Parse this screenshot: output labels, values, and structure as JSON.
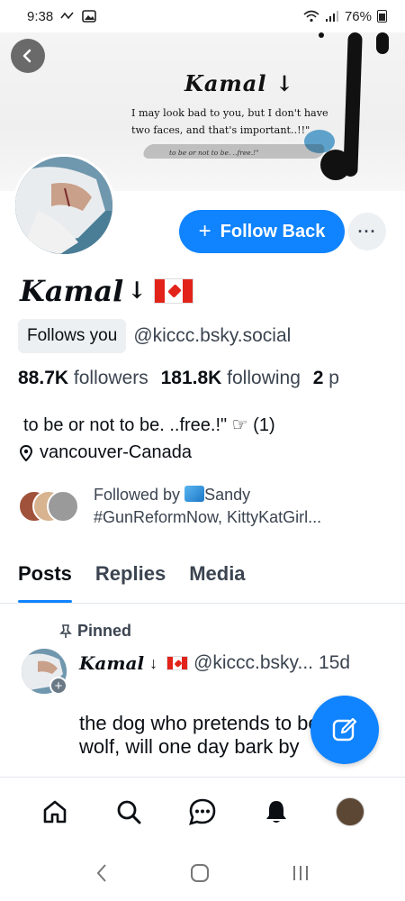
{
  "status_bar": {
    "time": "9:38",
    "battery": "76%"
  },
  "banner": {
    "title": "Kamal",
    "quote": "I may look bad to you, but I don't have two faces, and that's important..!!\"",
    "sub": "to be or not to be. ..free.!\""
  },
  "profile": {
    "display_name": "Kamal",
    "name_suffix": "↓",
    "follow_button": "Follow Back",
    "more_label": "···",
    "follows_you": "Follows you",
    "handle": "@kiccc.bsky.social",
    "followers_count": "88.7K",
    "followers_label": "followers",
    "following_count": "181.8K",
    "following_label": "following",
    "posts_count": "2",
    "posts_label": "p",
    "bio": "to be or not to be. ..free.!\" ☞ (1)",
    "location": "vancouver-Canada",
    "followed_by_line1": "Followed by ",
    "followed_by_name": "Sandy",
    "followed_by_line2": "#GunReformNow, KittyKatGirl..."
  },
  "tabs": [
    {
      "label": "Posts",
      "active": true
    },
    {
      "label": "Replies",
      "active": false
    },
    {
      "label": "Media",
      "active": false
    }
  ],
  "post": {
    "pinned_label": "Pinned",
    "author": "Kamal",
    "author_suffix": "↓",
    "handle": "@kiccc.bsky...",
    "time": "15d",
    "text": "the dog who pretends to be a wolf, will one day bark by"
  },
  "colors": {
    "accent": "#1083fe",
    "muted": "#3b4450"
  },
  "bottom_nav": [
    "home-icon",
    "search-icon",
    "chat-icon",
    "bell-icon",
    "profile-avatar"
  ]
}
